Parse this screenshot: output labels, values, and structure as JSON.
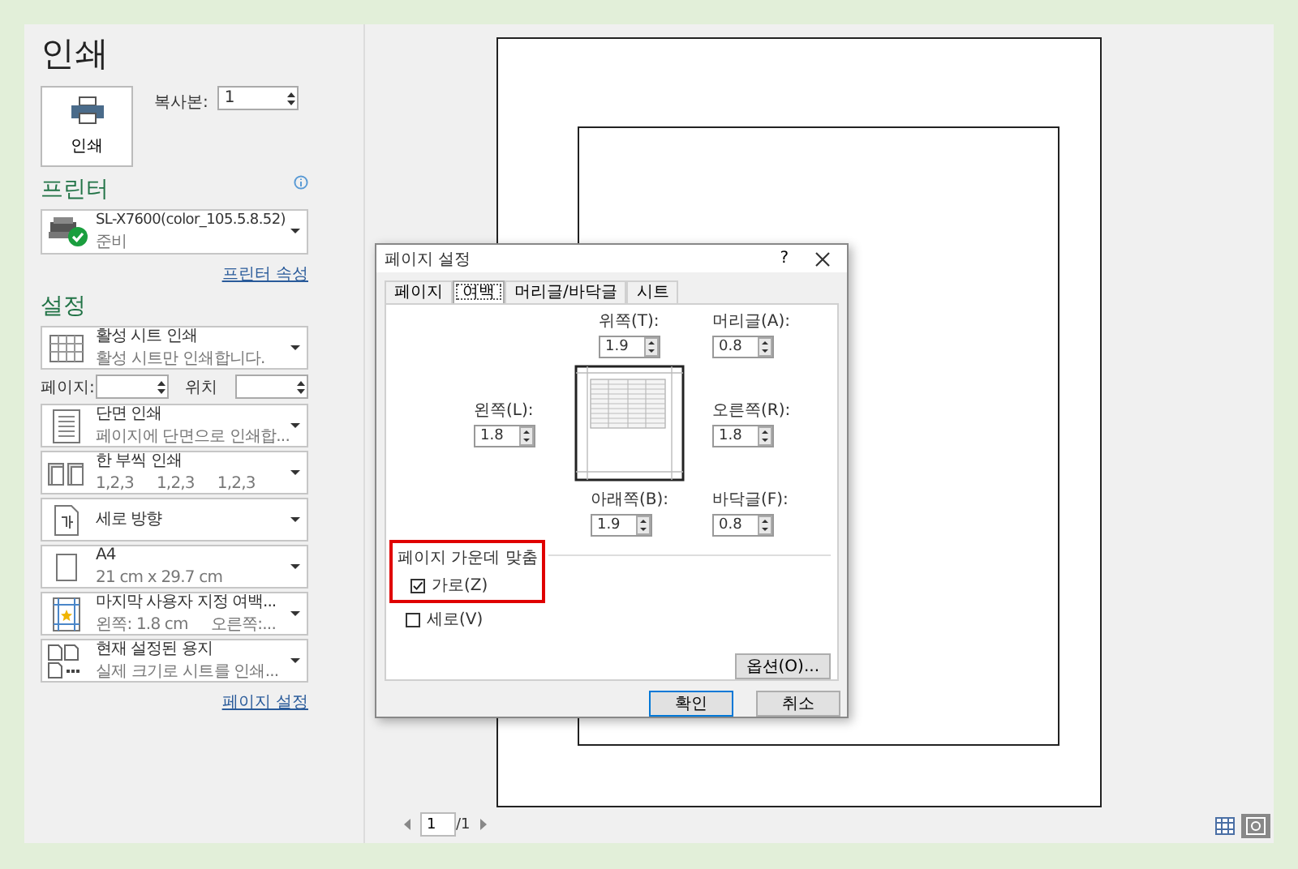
{
  "title": "인쇄",
  "print_button": {
    "label": "인쇄"
  },
  "copies": {
    "label": "복사본:",
    "value": "1"
  },
  "printer_heading": "프린터",
  "printer": {
    "name": "SL-X7600(color_105.5.8.52)",
    "status": "준비"
  },
  "printer_properties_link": "프린터 속성",
  "settings_heading": "설정",
  "settings": [
    {
      "kind": "sheets",
      "title": "활성 시트 인쇄",
      "subtitles": [
        "활성 시트만 인쇄합니다."
      ]
    },
    {
      "kind": "range",
      "from_label": "페이지:",
      "to_label": "위치"
    },
    {
      "kind": "sides",
      "title": "단면 인쇄",
      "subtitles": [
        "페이지에 단면으로 인쇄합..."
      ]
    },
    {
      "kind": "collate",
      "title": "한 부씩 인쇄",
      "subtitles": [
        "1,2,3",
        "1,2,3",
        "1,2,3"
      ]
    },
    {
      "kind": "orientation",
      "title": "세로 방향"
    },
    {
      "kind": "paper",
      "title": "A4",
      "subtitles": [
        "21 cm x 29.7 cm"
      ]
    },
    {
      "kind": "margins",
      "title": "마지막 사용자 지정 여백...",
      "subtitles": [
        "왼쪽:  1.8 cm",
        "오른쪽:..."
      ]
    },
    {
      "kind": "scaling",
      "title": "현재 설정된 용지",
      "subtitles": [
        "실제 크기로 시트를 인쇄..."
      ]
    }
  ],
  "page_setup_link": "페이지 설정",
  "dialog": {
    "title": "페이지 설정",
    "help": "?",
    "tabs": [
      {
        "label": "페이지",
        "selected": false
      },
      {
        "label": "여백",
        "selected": true
      },
      {
        "label": "머리글/바닥글",
        "selected": false
      },
      {
        "label": "시트",
        "selected": false
      }
    ],
    "top": {
      "label": "위쪽(T):",
      "value": "1.9"
    },
    "header": {
      "label": "머리글(A):",
      "value": "0.8"
    },
    "left": {
      "label": "왼쪽(L):",
      "value": "1.8"
    },
    "right": {
      "label": "오른쪽(R):",
      "value": "1.8"
    },
    "bottom": {
      "label": "아래쪽(B):",
      "value": "1.9"
    },
    "footer": {
      "label": "바닥글(F):",
      "value": "0.8"
    },
    "center_heading": "페이지 가운데 맞춤",
    "center_options": [
      {
        "label": "가로(Z)",
        "checked": true
      },
      {
        "label": "세로(V)",
        "checked": false
      }
    ],
    "options_button": "옵션(O)...",
    "ok_button": "확인",
    "cancel_button": "취소"
  },
  "pager": {
    "value": "1",
    "total": "/1"
  }
}
